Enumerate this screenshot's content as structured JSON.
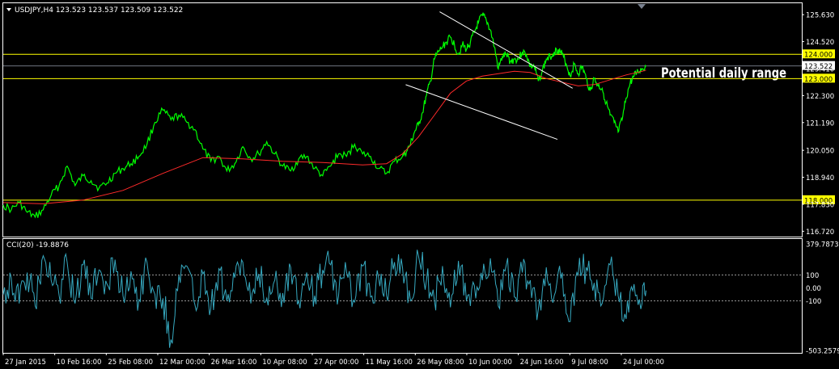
{
  "header": {
    "symbol_line": "USDJPY,H4  123.523 123.537 123.509 123.522"
  },
  "annotation": {
    "text": "Potential daily range"
  },
  "colors": {
    "background": "#000000",
    "price_line": "#00ff00",
    "moving_average": "#ff2a2a",
    "level_line": "#ffff00",
    "trend_line": "#ffffff",
    "cci_line": "#36a9c0",
    "axis_text": "#ffffff",
    "frame": "#ffffff"
  },
  "chart_data": [
    {
      "type": "line",
      "title": "",
      "ylim": [
        116.5,
        126.1
      ],
      "y_ticks": [
        "125.630",
        "124.520",
        "123.410",
        "122.300",
        "121.190",
        "120.050",
        "118.940",
        "117.830",
        "116.720"
      ],
      "y_tick_values": [
        125.63,
        124.52,
        123.41,
        122.3,
        121.19,
        120.05,
        118.94,
        117.83,
        116.72
      ],
      "x_tick_labels": [
        "27 Jan 2015",
        "10 Feb 16:00",
        "25 Feb 08:00",
        "12 Mar 00:00",
        "26 Mar 16:00",
        "10 Apr 08:00",
        "27 Apr 00:00",
        "11 May 16:00",
        "26 May 08:00",
        "10 Jun 00:00",
        "24 Jun 16:00",
        "9 Jul 08:00",
        "24 Jul 00:00"
      ],
      "x_tick_positions": [
        0.0,
        0.0645,
        0.129,
        0.1935,
        0.258,
        0.3225,
        0.387,
        0.4515,
        0.516,
        0.5805,
        0.645,
        0.7095,
        0.774
      ],
      "x_range": [
        0,
        0.807
      ],
      "series": [
        {
          "kind": "price",
          "x": [
            0.0,
            0.01,
            0.02,
            0.03,
            0.04,
            0.05,
            0.06,
            0.07,
            0.08,
            0.09,
            0.1,
            0.11,
            0.12,
            0.13,
            0.14,
            0.15,
            0.16,
            0.17,
            0.18,
            0.19,
            0.2,
            0.21,
            0.22,
            0.23,
            0.24,
            0.25,
            0.26,
            0.27,
            0.28,
            0.29,
            0.3,
            0.31,
            0.32,
            0.33,
            0.34,
            0.35,
            0.36,
            0.37,
            0.38,
            0.39,
            0.4,
            0.41,
            0.42,
            0.43,
            0.44,
            0.45,
            0.46,
            0.47,
            0.48,
            0.49,
            0.5,
            0.505,
            0.51,
            0.515,
            0.52,
            0.525,
            0.53,
            0.535,
            0.54,
            0.545,
            0.55,
            0.555,
            0.56,
            0.565,
            0.57,
            0.575,
            0.58,
            0.585,
            0.59,
            0.595,
            0.6,
            0.605,
            0.61,
            0.615,
            0.62,
            0.625,
            0.63,
            0.635,
            0.64,
            0.645,
            0.65,
            0.655,
            0.66,
            0.665,
            0.67,
            0.675,
            0.68,
            0.685,
            0.69,
            0.695,
            0.7,
            0.705,
            0.71,
            0.715,
            0.72,
            0.725,
            0.73,
            0.735,
            0.74,
            0.745,
            0.75,
            0.755,
            0.76,
            0.765,
            0.77,
            0.775,
            0.78,
            0.785,
            0.79,
            0.795,
            0.8,
            0.805
          ],
          "y": [
            117.8,
            117.6,
            117.9,
            117.5,
            117.3,
            117.6,
            118.2,
            118.6,
            119.4,
            118.6,
            119.0,
            118.8,
            118.5,
            118.7,
            119.1,
            119.3,
            119.5,
            119.8,
            120.3,
            121.2,
            121.7,
            121.3,
            121.5,
            121.2,
            120.9,
            120.1,
            119.6,
            119.8,
            119.2,
            119.5,
            120.2,
            119.7,
            119.9,
            120.4,
            119.9,
            119.4,
            119.2,
            119.7,
            119.8,
            119.3,
            119.0,
            119.4,
            119.9,
            119.8,
            120.3,
            119.9,
            119.8,
            119.3,
            119.1,
            119.6,
            119.8,
            120.0,
            120.3,
            120.8,
            121.1,
            121.6,
            122.3,
            122.9,
            123.8,
            124.1,
            124.3,
            124.5,
            124.7,
            124.4,
            124.0,
            124.4,
            124.2,
            124.5,
            124.9,
            125.3,
            125.6,
            125.4,
            125.0,
            124.3,
            123.4,
            123.9,
            124.0,
            123.7,
            123.8,
            123.8,
            124.1,
            124.0,
            123.5,
            123.5,
            122.9,
            123.3,
            123.8,
            123.9,
            124.1,
            124.2,
            124.0,
            123.6,
            123.1,
            123.6,
            123.2,
            123.5,
            123.0,
            122.5,
            123.0,
            122.7,
            122.6,
            122.0,
            121.5,
            121.2,
            120.8,
            121.3,
            122.2,
            122.8,
            123.1,
            123.3,
            123.4,
            123.5
          ]
        },
        {
          "kind": "moving_average",
          "x": [
            0.0,
            0.05,
            0.1,
            0.15,
            0.2,
            0.25,
            0.3,
            0.35,
            0.4,
            0.45,
            0.48,
            0.5,
            0.52,
            0.54,
            0.56,
            0.58,
            0.6,
            0.62,
            0.64,
            0.66,
            0.68,
            0.7,
            0.72,
            0.74,
            0.76,
            0.78,
            0.8,
            0.805
          ],
          "y": [
            117.9,
            117.85,
            118.0,
            118.4,
            119.1,
            119.75,
            119.7,
            119.6,
            119.55,
            119.45,
            119.5,
            119.9,
            120.6,
            121.5,
            122.4,
            122.9,
            123.1,
            123.2,
            123.3,
            123.25,
            123.0,
            122.85,
            122.7,
            122.75,
            122.95,
            123.15,
            123.3,
            123.35
          ]
        }
      ],
      "levels": [
        {
          "value": 124.0,
          "label": "124.000"
        },
        {
          "value": 123.0,
          "label": "123.000"
        },
        {
          "value": 118.0,
          "label": "118.000"
        }
      ],
      "current_price": {
        "value": 123.522,
        "label": "123.522"
      },
      "trend_lines": [
        {
          "from": [
            0.5465,
            125.75
          ],
          "to": [
            0.713,
            122.6
          ]
        },
        {
          "from": [
            0.504,
            122.75
          ],
          "to": [
            0.694,
            120.5
          ]
        }
      ]
    },
    {
      "type": "line",
      "title": "CCI(20) -19.8876",
      "ylim": [
        -503.2579,
        379.7873
      ],
      "y_ticks": [
        "379.7873",
        "100",
        "0.00",
        "-100",
        "-503.2579"
      ],
      "y_tick_values": [
        379.7873,
        100,
        0,
        -100,
        -503.2579
      ],
      "reference_lines": [
        100,
        -100
      ],
      "x_range": [
        0,
        0.807
      ],
      "series": [
        {
          "kind": "cci",
          "x": [
            0.0,
            0.01,
            0.02,
            0.03,
            0.04,
            0.05,
            0.06,
            0.07,
            0.08,
            0.09,
            0.1,
            0.11,
            0.12,
            0.13,
            0.14,
            0.15,
            0.16,
            0.17,
            0.18,
            0.19,
            0.2,
            0.21,
            0.22,
            0.23,
            0.24,
            0.25,
            0.26,
            0.27,
            0.28,
            0.29,
            0.3,
            0.31,
            0.32,
            0.33,
            0.34,
            0.35,
            0.36,
            0.37,
            0.38,
            0.39,
            0.4,
            0.41,
            0.42,
            0.43,
            0.44,
            0.45,
            0.46,
            0.47,
            0.48,
            0.49,
            0.5,
            0.51,
            0.52,
            0.53,
            0.54,
            0.55,
            0.56,
            0.57,
            0.58,
            0.59,
            0.6,
            0.61,
            0.62,
            0.63,
            0.64,
            0.65,
            0.66,
            0.67,
            0.68,
            0.69,
            0.7,
            0.71,
            0.72,
            0.73,
            0.74,
            0.75,
            0.76,
            0.77,
            0.78,
            0.79,
            0.8,
            0.805
          ],
          "y": [
            -50,
            80,
            -120,
            120,
            -140,
            250,
            60,
            -60,
            200,
            -120,
            180,
            -80,
            140,
            30,
            220,
            -60,
            130,
            -90,
            200,
            -50,
            -80,
            -400,
            100,
            170,
            -130,
            110,
            -160,
            150,
            -100,
            80,
            200,
            -120,
            110,
            -80,
            60,
            -40,
            160,
            -100,
            120,
            -60,
            140,
            180,
            -60,
            120,
            -110,
            170,
            -70,
            80,
            -60,
            200,
            160,
            -100,
            250,
            60,
            -100,
            170,
            -150,
            210,
            -100,
            20,
            60,
            230,
            -140,
            180,
            -70,
            120,
            60,
            -170,
            160,
            -60,
            120,
            -260,
            100,
            160,
            40,
            -120,
            180,
            -60,
            -240,
            30,
            -120,
            -20
          ]
        }
      ]
    }
  ]
}
